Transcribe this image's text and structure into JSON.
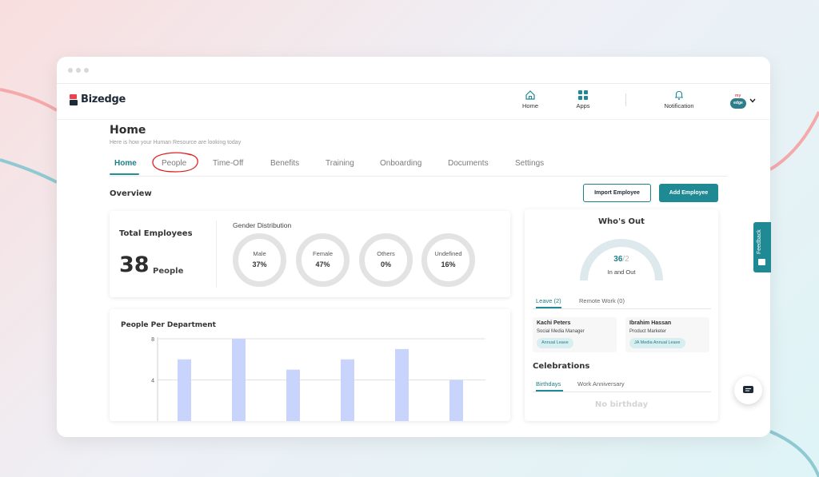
{
  "brand": {
    "name": "Bizedge"
  },
  "header": {
    "nav": [
      {
        "label": "Home",
        "icon": "home-icon"
      },
      {
        "label": "Apps",
        "icon": "apps-grid-icon"
      },
      {
        "label": "Notification",
        "icon": "bell-icon"
      }
    ],
    "avatar": {
      "top_text": "my",
      "bottom_text": "edge"
    }
  },
  "page": {
    "title": "Home",
    "subtitle": "Here is how your Human Resource are looking today",
    "tabs": [
      "Home",
      "People",
      "Time-Off",
      "Benefits",
      "Training",
      "Onboarding",
      "Documents",
      "Settings"
    ],
    "active_tab": "Home",
    "highlighted_tab": "People"
  },
  "overview": {
    "title": "Overview",
    "import_label": "Import Employee",
    "add_label": "Add Employee"
  },
  "employees": {
    "label": "Total Employees",
    "count": "38",
    "unit": "People",
    "gender_title": "Gender Distribution",
    "gender": [
      {
        "label": "Male",
        "value": "37%"
      },
      {
        "label": "Female",
        "value": "47%"
      },
      {
        "label": "Others",
        "value": "0%"
      },
      {
        "label": "Undefined",
        "value": "16%"
      }
    ]
  },
  "department": {
    "title": "People Per Department"
  },
  "chart_data": {
    "type": "bar",
    "title": "People Per Department",
    "categories": [
      "",
      "",
      "",
      "",
      "",
      ""
    ],
    "values": [
      6,
      8,
      5,
      6,
      7,
      4
    ],
    "ylim": [
      0,
      8
    ],
    "yticks": [
      "4",
      "8"
    ],
    "grid": true,
    "color": "#c8d4fb"
  },
  "whos_out": {
    "title": "Who's Out",
    "in_count": "36",
    "out_count": "/2",
    "gauge_label": "In and Out",
    "tabs": [
      {
        "label": "Leave (2)",
        "active": true
      },
      {
        "label": "Remote Work (0)",
        "active": false
      }
    ],
    "people": [
      {
        "name": "Kachi Peters",
        "role": "Social Media Manager",
        "badge": "Annual Leave"
      },
      {
        "name": "Ibrahim Hassan",
        "role": "Product Marketer",
        "badge": "JA Media Annual Leave"
      }
    ]
  },
  "celebrations": {
    "title": "Celebrations",
    "tabs": [
      "Birthdays",
      "Work Anniversary"
    ],
    "empty_text": "No birthday"
  },
  "feedback": {
    "label": "Feedback"
  },
  "colors": {
    "accent": "#1f8a93",
    "bar": "#c8d4fb",
    "annotation": "#e02020"
  }
}
